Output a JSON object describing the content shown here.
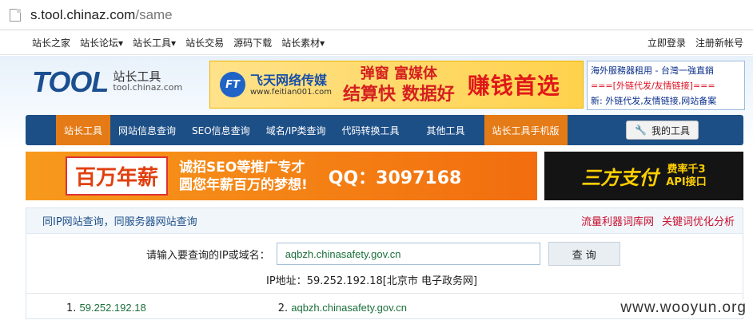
{
  "browser": {
    "url_host": "s.tool.chinaz.com",
    "url_path": "/same"
  },
  "topnav": {
    "left": [
      "站长之家",
      "站长论坛▾",
      "站长工具▾",
      "站长交易",
      "源码下载",
      "站长素材▾"
    ],
    "right": [
      "立即登录",
      "注册新帐号"
    ]
  },
  "logo": {
    "text": "TOOL",
    "cn": "站长工具",
    "en": "tool.chinaz.com"
  },
  "ad_feitian": {
    "logo": "FT",
    "name": "飞天网络传媒",
    "site": "www.feitian001.com",
    "line1": "弹窗 富媒体",
    "line2": "结算快 数据好",
    "slogan": "赚钱首选"
  },
  "sideinfo": {
    "line1": "海外服務器租用 - 台灣一強直銷",
    "line2": "===[外链代发/友情链接]===",
    "line3": "新: 外链代发,友情链接,网站备案"
  },
  "mainnav": {
    "items": [
      "站长工具",
      "网站信息查询",
      "SEO信息查询",
      "域名/IP类查询",
      "代码转换工具",
      "其他工具",
      "站长工具手机版"
    ],
    "mytools": "我的工具"
  },
  "ad_salary": {
    "box": "百万年薪",
    "line1": "诚招SEO等推广专才",
    "line2": "圆您年薪百万的梦想!",
    "qq": "QQ：3097168"
  },
  "ad_pay": {
    "brand": "三方支付",
    "line1": "费率千3",
    "line2": "API接口"
  },
  "panel": {
    "title": "同IP网站查询，同服务器网站查询",
    "links": [
      "流量利器词库网",
      "关键词优化分析"
    ],
    "label": "请输入要查询的IP或域名：",
    "input_value": "aqbzh.chinasafety.gov.cn",
    "button": "查 询",
    "ip_label": "IP地址：",
    "ip_value": "59.252.192.18[北京市 电子政务网]",
    "results": [
      {
        "num": "1.",
        "value": "59.252.192.18"
      },
      {
        "num": "2.",
        "value": "aqbzh.chinasafety.gov.cn"
      }
    ]
  },
  "watermark": "www.wooyun.org"
}
